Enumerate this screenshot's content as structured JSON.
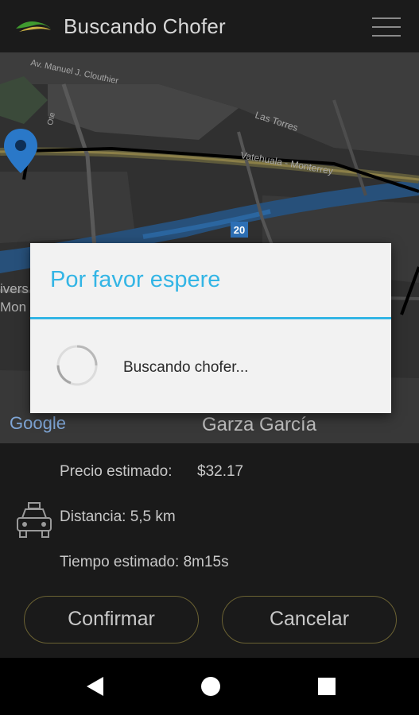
{
  "app_bar": {
    "title": "Buscando Chofer",
    "logo_icon": "leaf-logo-icon",
    "menu_icon": "hamburger-menu-icon"
  },
  "map": {
    "labels": {
      "street1": "Av. Manuel J. Clouthier",
      "street2": "Las Torres",
      "street3": "Vatehuala - Monterrey",
      "street4": "Ote",
      "route_badge": "20",
      "left_text1": "ivers",
      "left_text2": "Mon",
      "city": "Garza García",
      "google_logo": "Google"
    },
    "pin_icon": "map-pin-icon"
  },
  "dialog": {
    "title": "Por favor espere",
    "message": "Buscando chofer...",
    "spinner_icon": "loading-spinner-icon"
  },
  "trip_info": {
    "price_label": "Precio estimado:",
    "price_value": "$32.17",
    "distance": "Distancia: 5,5 km",
    "time": "Tiempo estimado: 8m15s",
    "taxi_icon": "taxi-icon"
  },
  "actions": {
    "confirm": "Confirmar",
    "cancel": "Cancelar"
  },
  "system_nav": {
    "back_icon": "back-triangle-icon",
    "home_icon": "home-circle-icon",
    "recents_icon": "recents-square-icon"
  },
  "colors": {
    "accent": "#33b5e5",
    "button_border": "#6b6233",
    "route": "#000000"
  }
}
